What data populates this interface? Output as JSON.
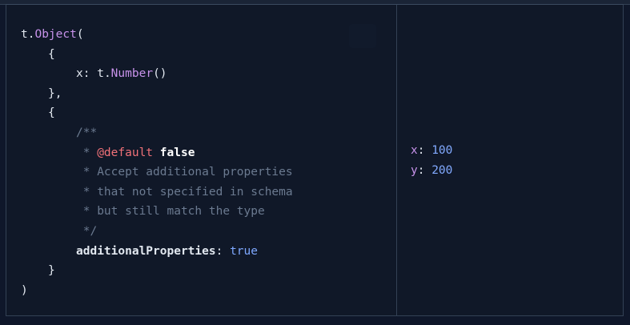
{
  "code": {
    "l1": {
      "obj": "t",
      "dot": ".",
      "fn": "Object",
      "open": "("
    },
    "l2": {
      "text": "{"
    },
    "l3": {
      "key": "x",
      "colon": ": ",
      "obj": "t",
      "dot": ".",
      "fn": "Number",
      "call": "()"
    },
    "l4": {
      "text": "},"
    },
    "l5": {
      "text": "{"
    },
    "c1": "/**",
    "c2": {
      "star": " * ",
      "tag": "@default",
      "space": " ",
      "value": "false"
    },
    "c3": " * Accept additional properties",
    "c4": " * that not specified in schema",
    "c5": " * but still match the type",
    "c6": " */",
    "l6": {
      "key": "additionalProperties",
      "colon": ": ",
      "value": "true"
    },
    "l7": {
      "text": "}"
    },
    "l8": {
      "text": ")"
    }
  },
  "result": {
    "x": {
      "key": "x",
      "colon": ": ",
      "value": "100"
    },
    "y": {
      "key": "y",
      "colon": ": ",
      "value": "200"
    }
  }
}
